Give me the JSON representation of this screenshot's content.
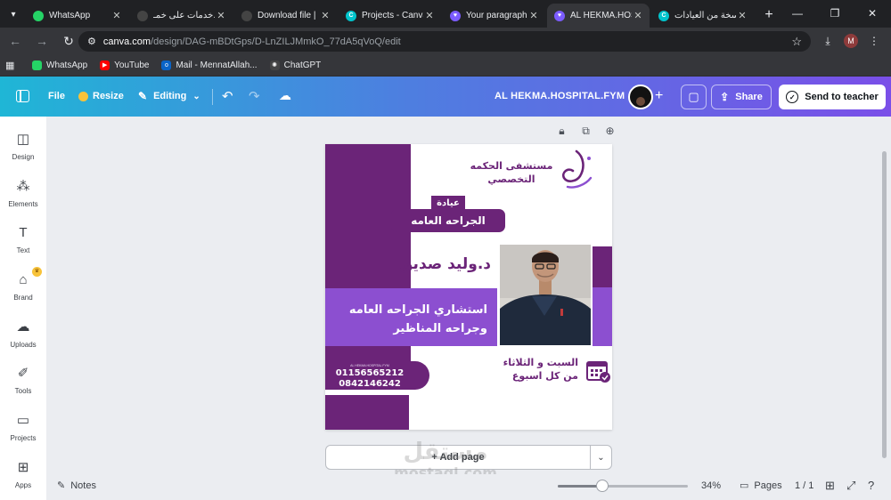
{
  "browser": {
    "tabs": [
      {
        "title": "WhatsApp",
        "favicon": "whatsapp-icon",
        "color": "#25d366"
      },
      {
        "title": "خدمات على خمـ...",
        "favicon": "openai-icon",
        "color": "#444444"
      },
      {
        "title": "Download file | ...",
        "favicon": "globe-icon",
        "color": "#444444"
      },
      {
        "title": "Projects - Canva",
        "favicon": "canva-icon",
        "color": "#00c4cc"
      },
      {
        "title": "Your paragraph",
        "favicon": "bookmark-heart-icon",
        "color": "#7c5cff"
      },
      {
        "title": "AL HEKMA.HOSP...",
        "favicon": "bookmark-heart-icon",
        "color": "#7c5cff"
      },
      {
        "title": "نسخة من العيادات",
        "favicon": "canva-icon",
        "color": "#00c4cc"
      }
    ],
    "url": {
      "host": "canva.com",
      "path": "/design/DAG-mBDtGps/D-LnZILJMmkO_77dA5qVoQ/edit"
    },
    "profile_initial": "M",
    "bookmarks": [
      {
        "label": "WhatsApp",
        "icon": "whatsapp-icon",
        "color": "#25d366"
      },
      {
        "label": "YouTube",
        "icon": "youtube-icon",
        "color": "#ff0000"
      },
      {
        "label": "Mail - MennatAllah...",
        "icon": "outlook-icon",
        "color": "#0a64c8"
      },
      {
        "label": "ChatGPT",
        "icon": "openai-icon",
        "color": "#444444"
      }
    ]
  },
  "header": {
    "file": "File",
    "resize": "Resize",
    "editing": "Editing",
    "title": "AL HEKMA.HOSPITAL.FYM",
    "share": "Share",
    "send": "Send to teacher"
  },
  "rail": [
    {
      "label": "Design",
      "icon": "design-icon"
    },
    {
      "label": "Elements",
      "icon": "elements-icon"
    },
    {
      "label": "Text",
      "icon": "text-icon"
    },
    {
      "label": "Brand",
      "icon": "brand-icon"
    },
    {
      "label": "Uploads",
      "icon": "uploads-icon"
    },
    {
      "label": "Tools",
      "icon": "tools-icon"
    },
    {
      "label": "Projects",
      "icon": "projects-icon"
    },
    {
      "label": "Apps",
      "icon": "apps-icon"
    }
  ],
  "design": {
    "hospital_line1": "مستشفى الحكمه",
    "hospital_line2": "التخصصي",
    "clinic_label": "عيادة",
    "clinic_name": "الجراحه العامه",
    "doctor_name": "د.وليد صديق",
    "specialty_line1": "استشاري الجراحه العامه",
    "specialty_line2": "وجراحه المناظير",
    "days_line1": "السبت و الثلاثاء",
    "days_line2": "من كل اسبوع",
    "phone_caption": "AL HEKMA HOSPITAL FYM",
    "phone1": "01156565212",
    "phone2": "0842146242",
    "colors": {
      "dark": "#6b2478",
      "mid": "#7a3fc2",
      "light": "#8c4fd0"
    }
  },
  "footer": {
    "add_page": "+ Add page",
    "notes": "Notes",
    "zoom": "34%",
    "zoom_fraction": 0.34,
    "pages": "Pages",
    "page_count": "1 / 1"
  },
  "watermark": {
    "line1": "مستقل",
    "line2": "mostaql.com"
  }
}
